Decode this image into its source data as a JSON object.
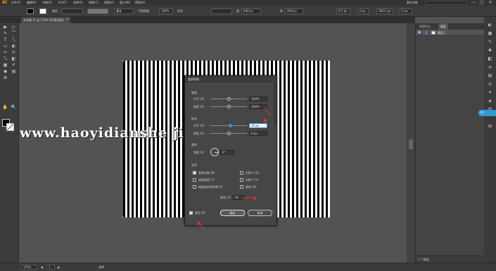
{
  "menubar": {
    "logo": "Ai",
    "items": [
      "文件(F)",
      "编辑(E)",
      "对象(O)",
      "文字(T)",
      "选择(S)",
      "效果(C)",
      "视图(V)",
      "窗口(W)",
      "帮助(H)"
    ],
    "workspace": "基本功能",
    "window_buttons": [
      "—",
      "□",
      "✕"
    ]
  },
  "controlbar": {
    "stroke_label": "描边",
    "stroke_weight": "",
    "brush_label": "基本",
    "opacity_label": "不透明度",
    "opacity_value": "100%",
    "style_label": "样式",
    "width_label": "宽",
    "width_value": "600 px",
    "height_label": "高",
    "height_value": "400 px",
    "x_value": "0.5 px",
    "y_value": "0 px",
    "angle_value": "300.5 px",
    "field_last": "0 px"
  },
  "document": {
    "tab_label": "未标题-2* @ 150% (RGB/预览)",
    "tab_close": "×"
  },
  "tools": {
    "icons": [
      "▶",
      "▷",
      "✎",
      "⌒",
      "T",
      "╲",
      "▭",
      "◐",
      "✂",
      "↻",
      "⤡",
      "◧",
      "▦",
      "✐",
      "◉",
      "▤",
      "⊞",
      "✋",
      "🔍"
    ]
  },
  "watermark": "www.haoyidianshe ji.com",
  "dialog": {
    "title": "变换效果",
    "scale_section": "缩放",
    "scale_h_label": "水平 (H)",
    "scale_h_value": "100%",
    "scale_v_label": "垂直 (V)",
    "scale_v_value": "100%",
    "move_section": "移动",
    "move_h_label": "水平 (O)",
    "move_h_value": "10 px",
    "move_v_label": "垂直 (E)",
    "move_v_value": "0 px",
    "rotate_section": "旋转",
    "angle_label": "角度 (A)",
    "angle_value": "0°",
    "options_section": "选项",
    "opt_transform_objects": "变换对象 (B)",
    "opt_transform_patterns": "变换图案 (T)",
    "opt_scale_strokes": "缩放描边和效果 (F)",
    "opt_reflect_x": "对称 X (X)",
    "opt_reflect_y": "对称 Y (Y)",
    "opt_random": "随机 (R)",
    "copies_label": "副本 (C)",
    "copies_value": "50",
    "preview_label": "预览 (P)",
    "ok": "确定",
    "cancel": "取消"
  },
  "layers_panel": {
    "tabs": [
      "资源导出",
      "图层"
    ],
    "layer_name": "图层 1",
    "bottom_text": "1 个图层"
  },
  "statusbar": {
    "zoom": "150%",
    "page": "1",
    "tool_name": "选择"
  },
  "colors": {
    "accent": "#3b8de0",
    "annotation_arrow": "#e03030",
    "badge": "#2e9bd6"
  }
}
